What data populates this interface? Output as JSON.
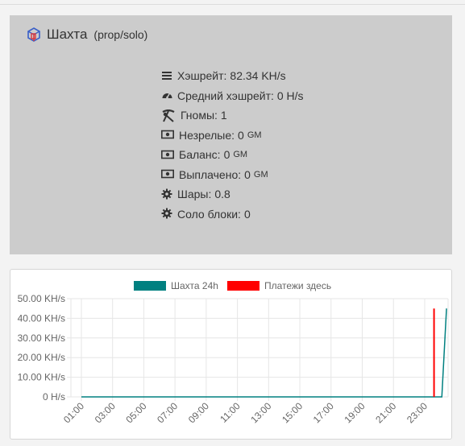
{
  "pool": {
    "title": "Шахта",
    "mode": "(prop/solo)",
    "stats": [
      {
        "icon": "bars-icon",
        "label": "Хэшрейт:",
        "value": "82.34 KH/s",
        "unit": ""
      },
      {
        "icon": "tachometer-icon",
        "label": "Средний хэшрейт:",
        "value": "0 H/s",
        "unit": ""
      },
      {
        "icon": "pick-shovel-icon",
        "label": "Гномы:",
        "value": "1",
        "unit": ""
      },
      {
        "icon": "money-icon",
        "label": "Незрелые:",
        "value": "0",
        "unit": "GM"
      },
      {
        "icon": "money-icon",
        "label": "Баланс:",
        "value": "0",
        "unit": "GM"
      },
      {
        "icon": "money-icon",
        "label": "Выплачено:",
        "value": "0",
        "unit": "GM"
      },
      {
        "icon": "gear-icon",
        "label": "Шары:",
        "value": "0.8",
        "unit": ""
      },
      {
        "icon": "gear-icon",
        "label": "Соло блоки:",
        "value": "0",
        "unit": ""
      }
    ]
  },
  "colors": {
    "series_hashrate": "#008080",
    "series_payments": "#ff0000",
    "grid": "#e6e6e6"
  },
  "chart_data": {
    "type": "line",
    "legend": "top",
    "grid": true,
    "series": [
      {
        "name": "Шахта 24h",
        "color": "#008080"
      },
      {
        "name": "Платежи здесь",
        "color": "#ff0000"
      }
    ],
    "x_ticks": [
      "01:00",
      "03:00",
      "05:00",
      "07:00",
      "09:00",
      "11:00",
      "13:00",
      "15:00",
      "17:00",
      "19:00",
      "21:00",
      "23:00"
    ],
    "y_ticks": [
      "50.00 KH/s",
      "40.00 KH/s",
      "30.00 KH/s",
      "20.00 KH/s",
      "10.00 KH/s",
      "0 H/s"
    ],
    "ylim": [
      0,
      50
    ],
    "hashrate_points": [
      {
        "x": 1.0,
        "y": 0
      },
      {
        "x": 24.1,
        "y": 0
      },
      {
        "x": 24.4,
        "y": 45
      }
    ],
    "payment_time": 23.6,
    "payment_value": 45,
    "xlim": [
      0.33,
      24.5
    ]
  }
}
